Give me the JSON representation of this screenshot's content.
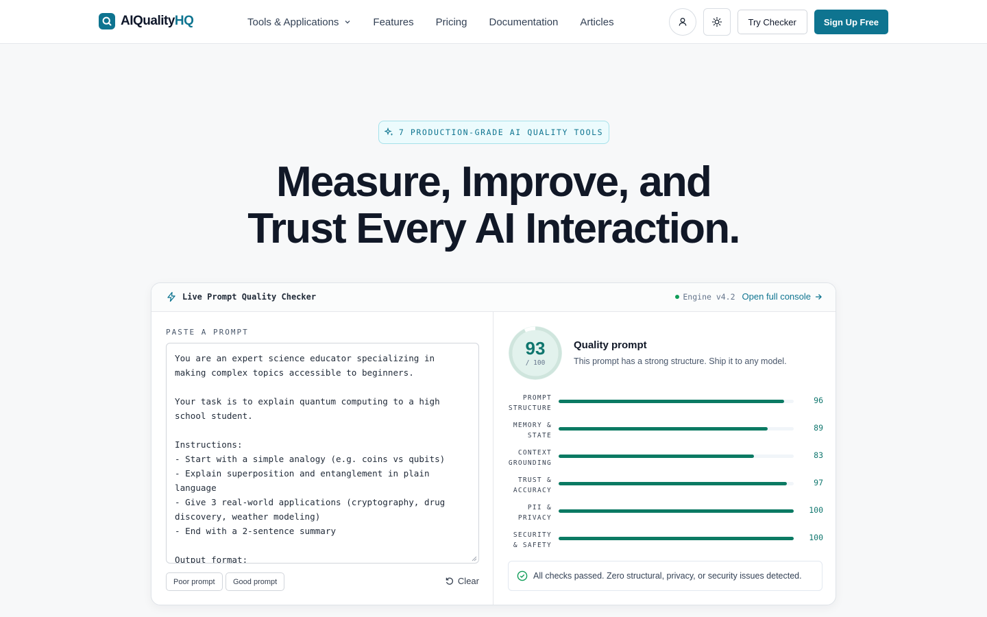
{
  "brand": {
    "name_main": "AIQuality",
    "name_accent": "HQ",
    "accent": "#0e7490"
  },
  "nav": {
    "links": [
      {
        "label": "Tools & Applications",
        "has_dropdown": true
      },
      {
        "label": "Features"
      },
      {
        "label": "Pricing"
      },
      {
        "label": "Documentation"
      },
      {
        "label": "Articles"
      }
    ],
    "icons": {
      "user": "user-icon",
      "theme": "sun-icon"
    },
    "try_label": "Try Checker",
    "signup_label": "Sign Up Free"
  },
  "hero": {
    "badge": "7 PRODUCTION-GRADE AI QUALITY TOOLS",
    "title_line1": "Measure, Improve, and",
    "title_line2": "Trust Every AI Interaction."
  },
  "checker": {
    "title": "Live Prompt Quality Checker",
    "engine": "Engine v4.2",
    "open_console": "Open full console",
    "paste_label": "PASTE A PROMPT",
    "prompt_text": "You are an expert science educator specializing in\nmaking complex topics accessible to beginners.\n\nYour task is to explain quantum computing to a high\nschool student.\n\nInstructions:\n- Start with a simple analogy (e.g. coins vs qubits)\n- Explain superposition and entanglement in plain\nlanguage\n- Give 3 real-world applications (cryptography, drug\ndiscovery, weather modeling)\n- End with a 2-sentence summary\n\nOutput format:",
    "chips": [
      "Poor prompt",
      "Good prompt"
    ],
    "clear_label": "Clear",
    "score": 93,
    "score_max": "/ 100",
    "quality_title": "Quality prompt",
    "quality_sub": "This prompt has a strong structure. Ship it to any model.",
    "metrics": [
      {
        "line1": "PROMPT",
        "line2": "STRUCTURE",
        "value": 96
      },
      {
        "line1": "MEMORY &",
        "line2": "STATE",
        "value": 89
      },
      {
        "line1": "CONTEXT",
        "line2": "GROUNDING",
        "value": 83
      },
      {
        "line1": "TRUST &",
        "line2": "ACCURACY",
        "value": 97
      },
      {
        "line1": "PII &",
        "line2": "PRIVACY",
        "value": 100
      },
      {
        "line1": "SECURITY",
        "line2": "& SAFETY",
        "value": 100
      }
    ],
    "passed_message": "All checks passed. Zero structural, privacy, or security issues detected.",
    "bar_color": "#0b7a63"
  }
}
